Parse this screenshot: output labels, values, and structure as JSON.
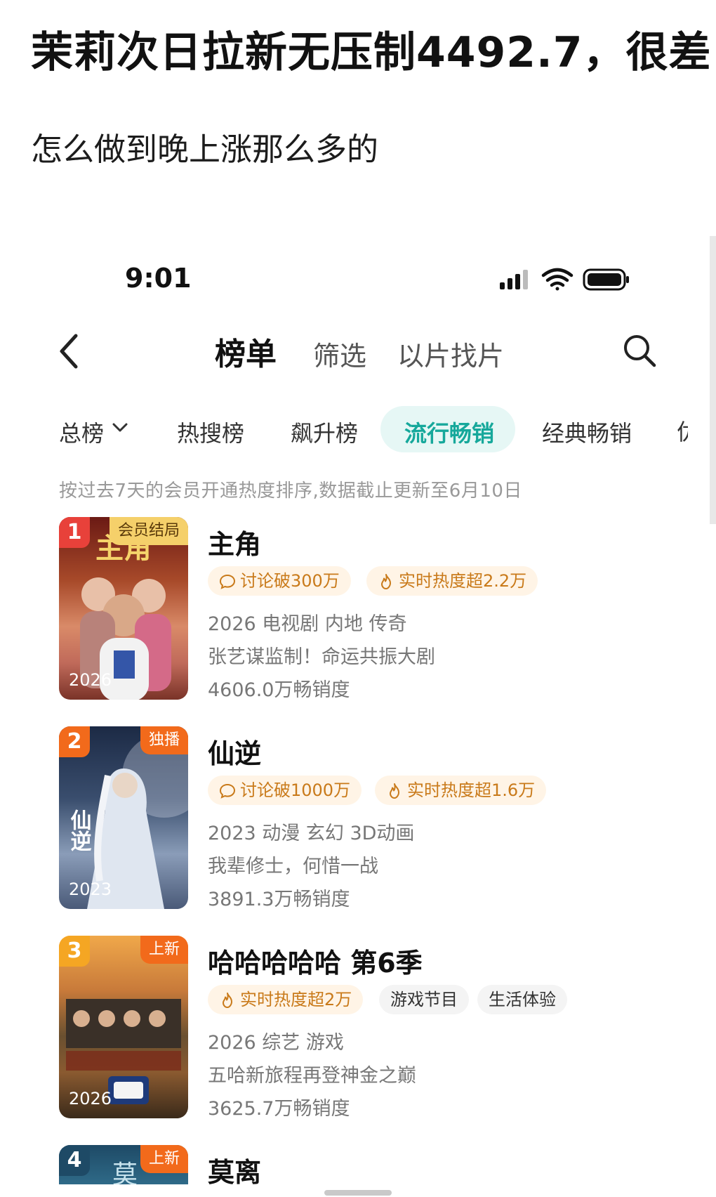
{
  "post": {
    "headline": "茉莉次日拉新无压制4492.7，很差",
    "subline": "怎么做到晚上涨那么多的"
  },
  "status_bar": {
    "time": "9:01"
  },
  "nav": {
    "main": "榜单",
    "filter": "筛选",
    "find": "以片找片"
  },
  "categories": [
    {
      "label": "总榜"
    },
    {
      "label": "热搜榜"
    },
    {
      "label": "飙升榜"
    },
    {
      "label": "流行畅销",
      "active": true
    },
    {
      "label": "经典畅销"
    },
    {
      "label": "优"
    }
  ],
  "note": "按过去7天的会员开通热度排序,数据截止更新至6月10日",
  "items": [
    {
      "rank": "1",
      "poster_tag": "会员结局",
      "poster_year": "2026",
      "poster_text": "主角",
      "title": "主角",
      "badges": [
        "讨论破300万",
        "实时热度超2.2万"
      ],
      "meta1": "2026 电视剧 内地 传奇",
      "meta2": "张艺谋监制！命运共振大剧",
      "meta3": "4606.0万畅销度"
    },
    {
      "rank": "2",
      "poster_tag": "独播",
      "poster_year": "2023",
      "poster_text": "仙逆",
      "title": "仙逆",
      "badges": [
        "讨论破1000万",
        "实时热度超1.6万"
      ],
      "meta1": "2023 动漫 玄幻 3D动画",
      "meta2": "我辈修士，何惜一战",
      "meta3": "3891.3万畅销度"
    },
    {
      "rank": "3",
      "poster_tag": "上新",
      "poster_year": "2026",
      "poster_text": "",
      "title": "哈哈哈哈哈 第6季",
      "badges": [
        "实时热度超2万",
        "游戏节目",
        "生活体验"
      ],
      "meta1": "2026 综艺 游戏",
      "meta2": "五哈新旅程再登神金之巅",
      "meta3": "3625.7万畅销度"
    },
    {
      "rank": "4",
      "poster_tag": "上新",
      "poster_year": "",
      "poster_text": "莫",
      "title": "莫离"
    }
  ],
  "colors": {
    "accent": "#16a89b",
    "badge_text": "#c97a1a",
    "rank1": "#e8413a",
    "rank2": "#f26a1b",
    "rank3": "#f5a623",
    "rank4": "#1e4a66"
  },
  "icons": [
    "back-icon",
    "search-icon",
    "chevron-down-icon",
    "signal-icon",
    "wifi-icon",
    "battery-icon",
    "comment-icon",
    "flame-icon"
  ]
}
